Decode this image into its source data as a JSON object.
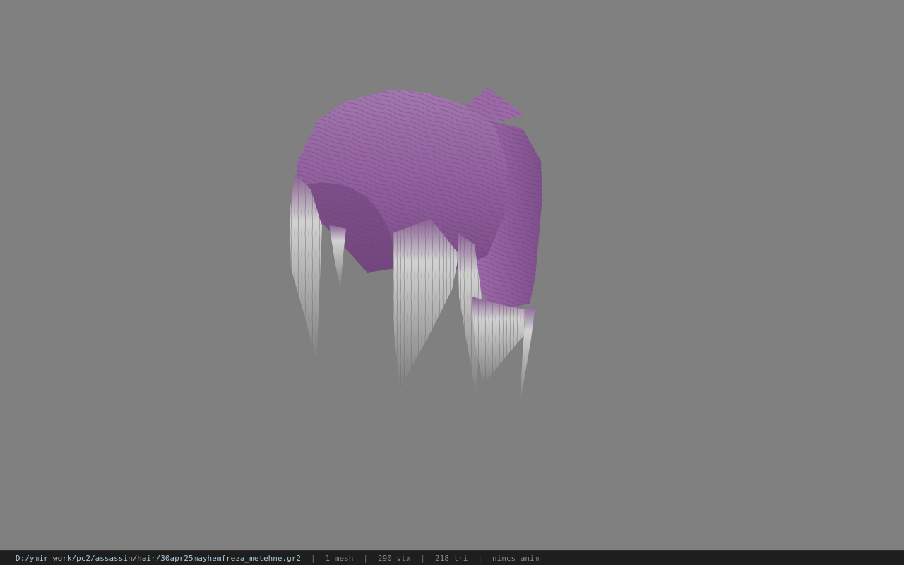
{
  "viewer": {
    "background_color": "#808080",
    "model": {
      "name": "hair-mesh",
      "hair_color": "#9a6aa6",
      "tip_color": "#c8c8c8"
    }
  },
  "status_bar": {
    "file_path": "D:/ymir work/pc2/assassin/hair/30apr25mayhemfreza_metehne.gr2",
    "separator": "|",
    "mesh_count": "1 mesh",
    "vertex_count": "290 vtx",
    "triangle_count": "218 tri",
    "animation": "nincs anim"
  }
}
